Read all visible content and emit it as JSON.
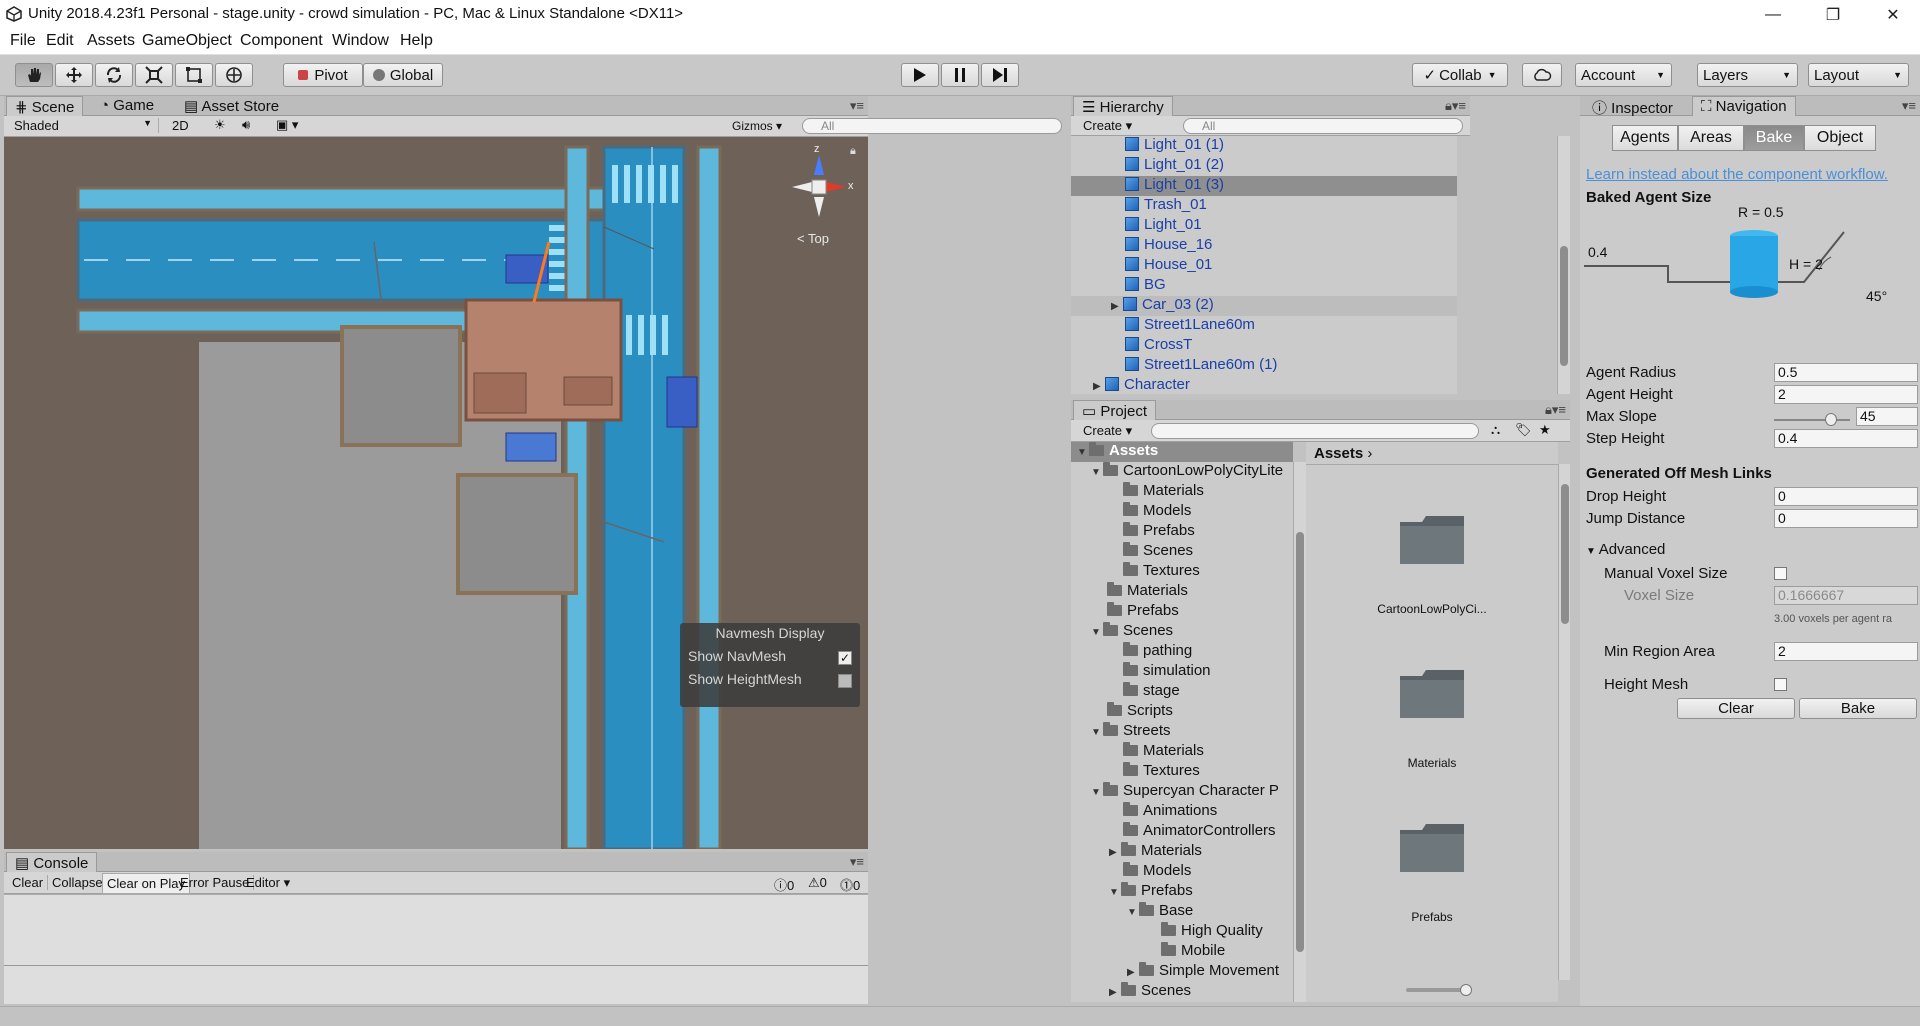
{
  "window": {
    "title": "Unity 2018.4.23f1 Personal - stage.unity - crowd simulation - PC, Mac & Linux Standalone <DX11>"
  },
  "menu": [
    "File",
    "Edit",
    "Assets",
    "GameObject",
    "Component",
    "Window",
    "Help"
  ],
  "toolbar": {
    "pivot": "Pivot",
    "global": "Global",
    "collab": "Collab",
    "account": "Account",
    "layers": "Layers",
    "layout": "Layout"
  },
  "scene": {
    "tabs": [
      "Scene",
      "Game",
      "Asset Store"
    ],
    "shading": "Shaded",
    "mode_2d": "2D",
    "gizmos": "Gizmos",
    "search_placeholder": "All",
    "view_label": "Top",
    "gizmo_x": "x",
    "gizmo_z": "z",
    "navmesh_display": {
      "title": "Navmesh Display",
      "show_navmesh": "Show NavMesh",
      "show_heightmesh": "Show HeightMesh",
      "show_navmesh_checked": true,
      "show_heightmesh_checked": false
    }
  },
  "console": {
    "tab": "Console",
    "buttons": [
      "Clear",
      "Collapse",
      "Clear on Play",
      "Error Pause",
      "Editor"
    ],
    "counts": [
      "0",
      "0",
      "0"
    ]
  },
  "hierarchy": {
    "tab": "Hierarchy",
    "create": "Create",
    "search_placeholder": "All",
    "items": [
      {
        "label": "Light_01 (1)",
        "selected": false,
        "expandable": false
      },
      {
        "label": "Light_01 (2)",
        "selected": false,
        "expandable": false
      },
      {
        "label": "Light_01 (3)",
        "selected": true,
        "expandable": false
      },
      {
        "label": "Trash_01",
        "selected": false,
        "expandable": false
      },
      {
        "label": "Light_01",
        "selected": false,
        "expandable": false
      },
      {
        "label": "House_16",
        "selected": false,
        "expandable": false
      },
      {
        "label": "House_01",
        "selected": false,
        "expandable": false
      },
      {
        "label": "BG",
        "selected": false,
        "expandable": false
      },
      {
        "label": "Car_03 (2)",
        "selected": false,
        "expandable": true
      },
      {
        "label": "Street1Lane60m",
        "selected": false,
        "expandable": false
      },
      {
        "label": "CrossT",
        "selected": false,
        "expandable": false
      },
      {
        "label": "Street1Lane60m (1)",
        "selected": false,
        "expandable": false
      },
      {
        "label": "Character",
        "selected": false,
        "expandable": true
      }
    ]
  },
  "project": {
    "tab": "Project",
    "create": "Create",
    "tree": [
      {
        "label": "Assets",
        "depth": 0,
        "open": true
      },
      {
        "label": "CartoonLowPolyCityLite",
        "depth": 1,
        "open": true
      },
      {
        "label": "Materials",
        "depth": 2
      },
      {
        "label": "Models",
        "depth": 2
      },
      {
        "label": "Prefabs",
        "depth": 2
      },
      {
        "label": "Scenes",
        "depth": 2
      },
      {
        "label": "Textures",
        "depth": 2
      },
      {
        "label": "Materials",
        "depth": 1
      },
      {
        "label": "Prefabs",
        "depth": 1
      },
      {
        "label": "Scenes",
        "depth": 1,
        "open": true
      },
      {
        "label": "pathing",
        "depth": 2
      },
      {
        "label": "simulation",
        "depth": 2
      },
      {
        "label": "stage",
        "depth": 2
      },
      {
        "label": "Scripts",
        "depth": 1
      },
      {
        "label": "Streets",
        "depth": 1,
        "open": true
      },
      {
        "label": "Materials",
        "depth": 2
      },
      {
        "label": "Textures",
        "depth": 2
      },
      {
        "label": "Supercyan Character P",
        "depth": 1,
        "open": true
      },
      {
        "label": "Animations",
        "depth": 2
      },
      {
        "label": "AnimatorControllers",
        "depth": 2
      },
      {
        "label": "Materials",
        "depth": 2,
        "closed": true
      },
      {
        "label": "Models",
        "depth": 2
      },
      {
        "label": "Prefabs",
        "depth": 2,
        "open": true
      },
      {
        "label": "Base",
        "depth": 3,
        "open": true
      },
      {
        "label": "High Quality",
        "depth": 4
      },
      {
        "label": "Mobile",
        "depth": 4
      },
      {
        "label": "Simple Movement",
        "depth": 3,
        "closed": true
      },
      {
        "label": "Scenes",
        "depth": 2,
        "closed": true
      }
    ],
    "breadcrumb": "Assets",
    "grid": [
      "CartoonLowPolyCi...",
      "Materials",
      "Prefabs"
    ]
  },
  "inspector": {
    "tabs": [
      "Inspector",
      "Navigation"
    ],
    "nav_tabs": [
      "Agents",
      "Areas",
      "Bake",
      "Object"
    ],
    "link": "Learn instead about the component workflow.",
    "baked_agent_size": "Baked Agent Size",
    "diagram": {
      "r": "R = 0.5",
      "h": "H = 2",
      "step": "0.4",
      "slope": "45°"
    },
    "fields": [
      {
        "label": "Agent Radius",
        "value": "0.5"
      },
      {
        "label": "Agent Height",
        "value": "2"
      },
      {
        "label": "Max Slope",
        "value": "45",
        "slider_fraction": 0.75
      },
      {
        "label": "Step Height",
        "value": "0.4"
      }
    ],
    "generated_off_mesh_links": "Generated Off Mesh Links",
    "offmesh_fields": [
      {
        "label": "Drop Height",
        "value": "0"
      },
      {
        "label": "Jump Distance",
        "value": "0"
      }
    ],
    "advanced": "Advanced",
    "manual_voxel_size": "Manual Voxel Size",
    "voxel_size": "Voxel Size",
    "voxel_size_value": "0.1666667",
    "voxel_hint": "3.00 voxels per agent ra",
    "min_region_area": "Min Region Area",
    "min_region_area_value": "2",
    "height_mesh": "Height Mesh",
    "clear": "Clear",
    "bake": "Bake"
  },
  "colors": {
    "link": "#4a90d9",
    "scene_ground": "#6e6258",
    "road_blue": "#2a8fc0",
    "hierarchy_text": "#1a3fa8"
  }
}
